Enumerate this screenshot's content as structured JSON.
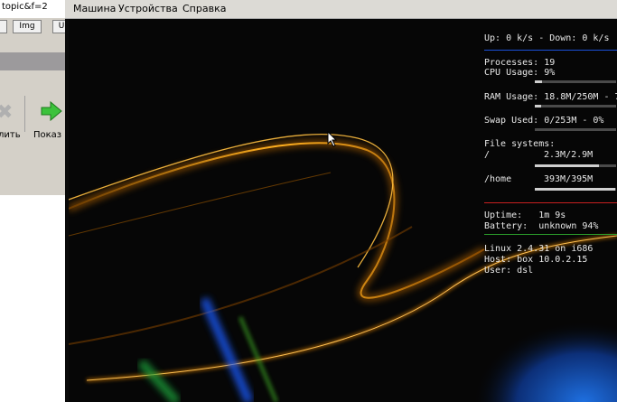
{
  "background_window": {
    "url_fragment": "topic&f=2",
    "buttons": [
      "",
      "Img",
      "U"
    ],
    "toolbar": {
      "left_label": "лить",
      "right_label": "Показ"
    }
  },
  "vm_window": {
    "menu": [
      "Машина",
      "Устройства",
      "Справка"
    ]
  },
  "monitor": {
    "net": "Up: 0 k/s - Down: 0 k/s",
    "processes": "Processes: 19",
    "cpu": "CPU Usage: 9%",
    "cpu_percent": 9,
    "ram": "RAM Usage: 18.8M/250M - 7",
    "ram_fraction": 0.075,
    "swap": "Swap Used: 0/253M - 0%",
    "swap_fraction": 0,
    "fs_header": "File systems:",
    "fs_root_label": "/",
    "fs_root_value": "2.3M/2.9M",
    "fs_root_fraction": 0.79,
    "fs_home_label": "/home",
    "fs_home_value": "393M/395M",
    "fs_home_fraction": 0.99,
    "uptime": "Uptime:   1m 9s",
    "battery": "Battery:  unknown 94%",
    "kernel": "Linux 2.4.31 on i686",
    "host": "Host: box 10.0.2.15",
    "user": "User: dsl",
    "colors": {
      "top_rule": "#1a4fd8",
      "mid_rule": "#c82020",
      "green_rule": "#2a9a2a"
    }
  }
}
